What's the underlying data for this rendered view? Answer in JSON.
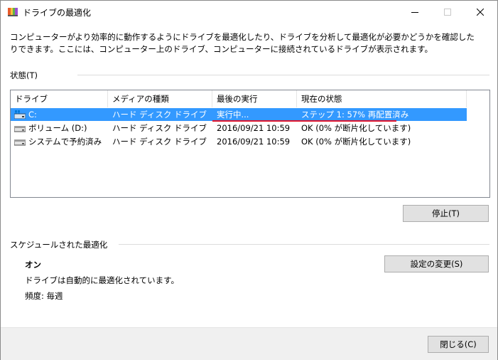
{
  "window": {
    "title": "ドライブの最適化",
    "minimize_icon": "minimize-icon",
    "maximize_icon": "maximize-icon",
    "close_icon": "close-icon"
  },
  "description": "コンピューターがより効率的に動作するようにドライブを最適化したり、ドライブを分析して最適化が必要かどうかを確認したりできます。ここには、コンピューター上のドライブ、コンピューターに接続されているドライブが表示されます。",
  "status_section": {
    "label": "状態(T)",
    "columns": [
      "ドライブ",
      "メディアの種類",
      "最後の実行",
      "現在の状態"
    ],
    "drives": [
      {
        "name": "C:",
        "media": "ハード ディスク ドライブ",
        "last_run": "実行中...",
        "status": "ステップ 1: 57% 再配置済み",
        "selected": true,
        "icon": "windows-drive-icon"
      },
      {
        "name": "ボリューム (D:)",
        "media": "ハード ディスク ドライブ",
        "last_run": "2016/09/21 10:59",
        "status": "OK (0% が断片化しています)",
        "selected": false,
        "icon": "hard-drive-icon"
      },
      {
        "name": "システムで予約済み",
        "media": "ハード ディスク ドライブ",
        "last_run": "2016/09/21 10:59",
        "status": "OK (0% が断片化しています)",
        "selected": false,
        "icon": "hard-drive-icon"
      }
    ],
    "stop_button": "停止(T)"
  },
  "schedule_section": {
    "label": "スケジュールされた最適化",
    "state": "オン",
    "info": "ドライブは自動的に最適化されています。",
    "frequency": "頻度: 毎週",
    "change_settings_button": "設定の変更(S)"
  },
  "footer": {
    "close_button": "閉じる(C)"
  },
  "colors": {
    "selection": "#3399ff",
    "highlight_underline": "#e0142c",
    "button_bg": "#e1e1e1",
    "footer_bg": "#f0f0f0"
  }
}
